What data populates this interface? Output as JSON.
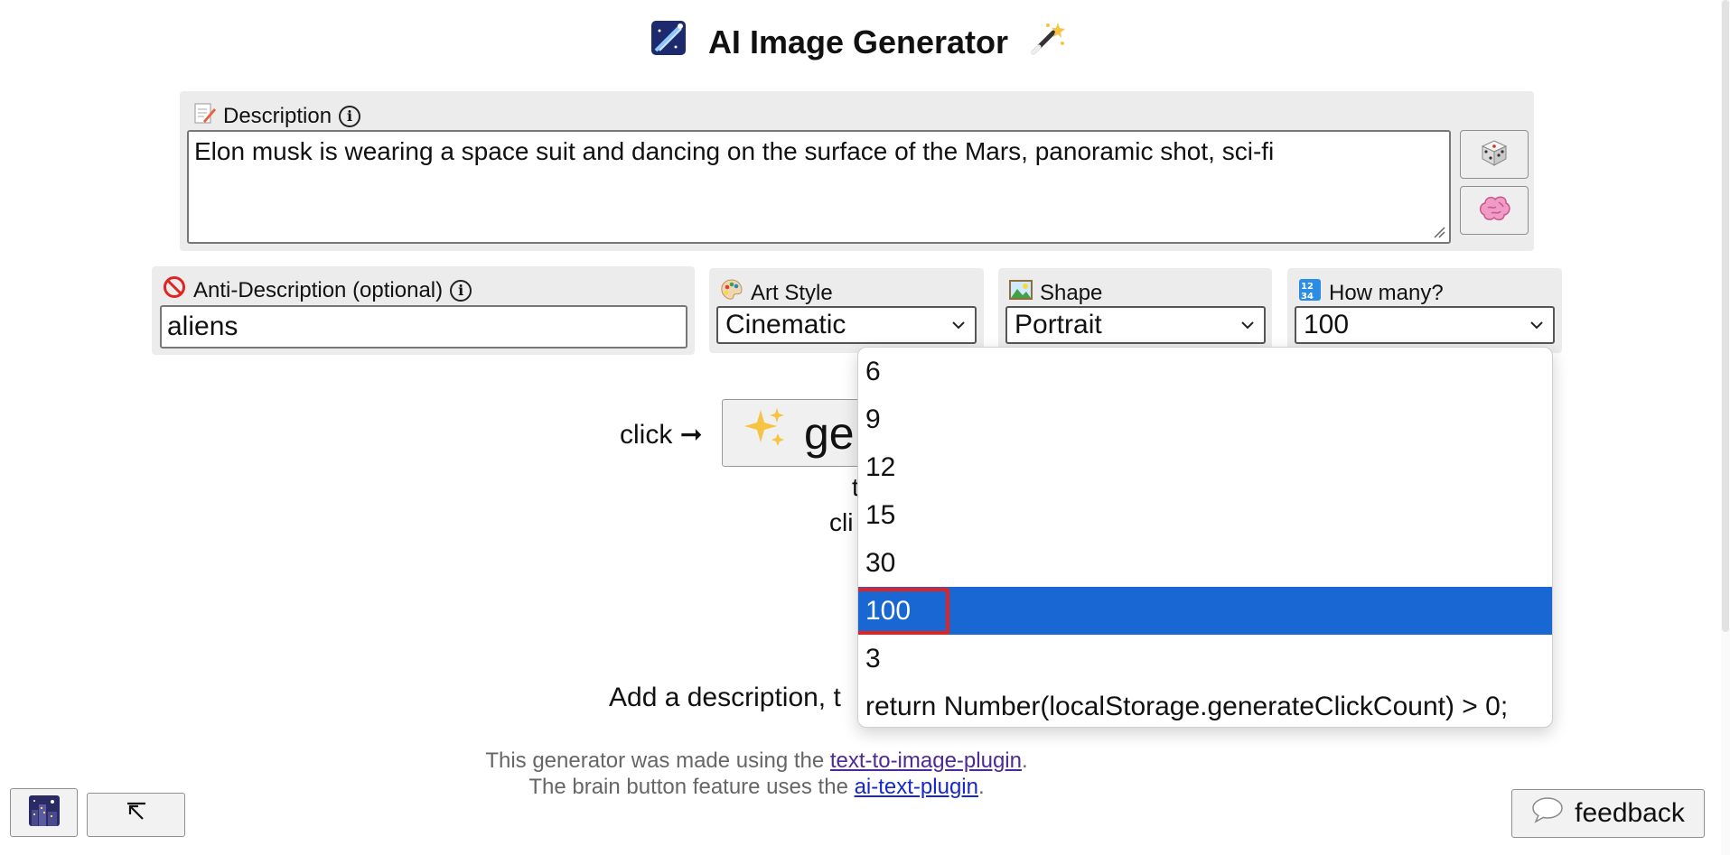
{
  "title": {
    "text": "AI Image Generator",
    "left_icon": "shooting-star-icon",
    "right_icon": "magic-wand-icon"
  },
  "description": {
    "label": "Description",
    "value": "Elon musk is wearing a space suit and dancing on the surface of the Mars, panoramic shot, sci-fi",
    "label_icon": "memo-icon",
    "randomize_icon": "dice-icon",
    "brain_icon": "brain-icon"
  },
  "anti_description": {
    "label": "Anti-Description (optional)",
    "value": "aliens",
    "label_icon": "no-entry-icon"
  },
  "art_style": {
    "label": "Art Style",
    "value": "Cinematic",
    "label_icon": "palette-icon"
  },
  "shape": {
    "label": "Shape",
    "value": "Portrait",
    "label_icon": "picture-icon"
  },
  "how_many": {
    "label": "How many?",
    "value": "100",
    "label_icon": "numbers-icon",
    "options": [
      "6",
      "9",
      "12",
      "15",
      "30",
      "100",
      "3",
      "return Number(localStorage.generateClickCount) > 0;"
    ],
    "selected": "100"
  },
  "generate": {
    "click_text": "click ➞",
    "button_text": "ge",
    "under_text_1": "t",
    "under_text_2": "cli",
    "sparkles_icon": "sparkles-icon"
  },
  "hint": {
    "text": "Add a description, t"
  },
  "footer": {
    "line1_prefix": "This generator was made using the ",
    "line1_link": "text-to-image-plugin",
    "line1_suffix": ".",
    "line2_prefix": "The brain button feature uses the ",
    "line2_link": "ai-text-plugin",
    "line2_suffix": "."
  },
  "bottom": {
    "gallery_icon": "night-city-icon",
    "expand_icon": "arrow-up-left-icon",
    "feedback_label": "feedback",
    "feedback_icon": "speech-bubble-icon"
  },
  "colors": {
    "panel": "#ececec",
    "selected_option": "#1967d2",
    "highlight_outline": "#e32222",
    "link": "#1528c9"
  }
}
